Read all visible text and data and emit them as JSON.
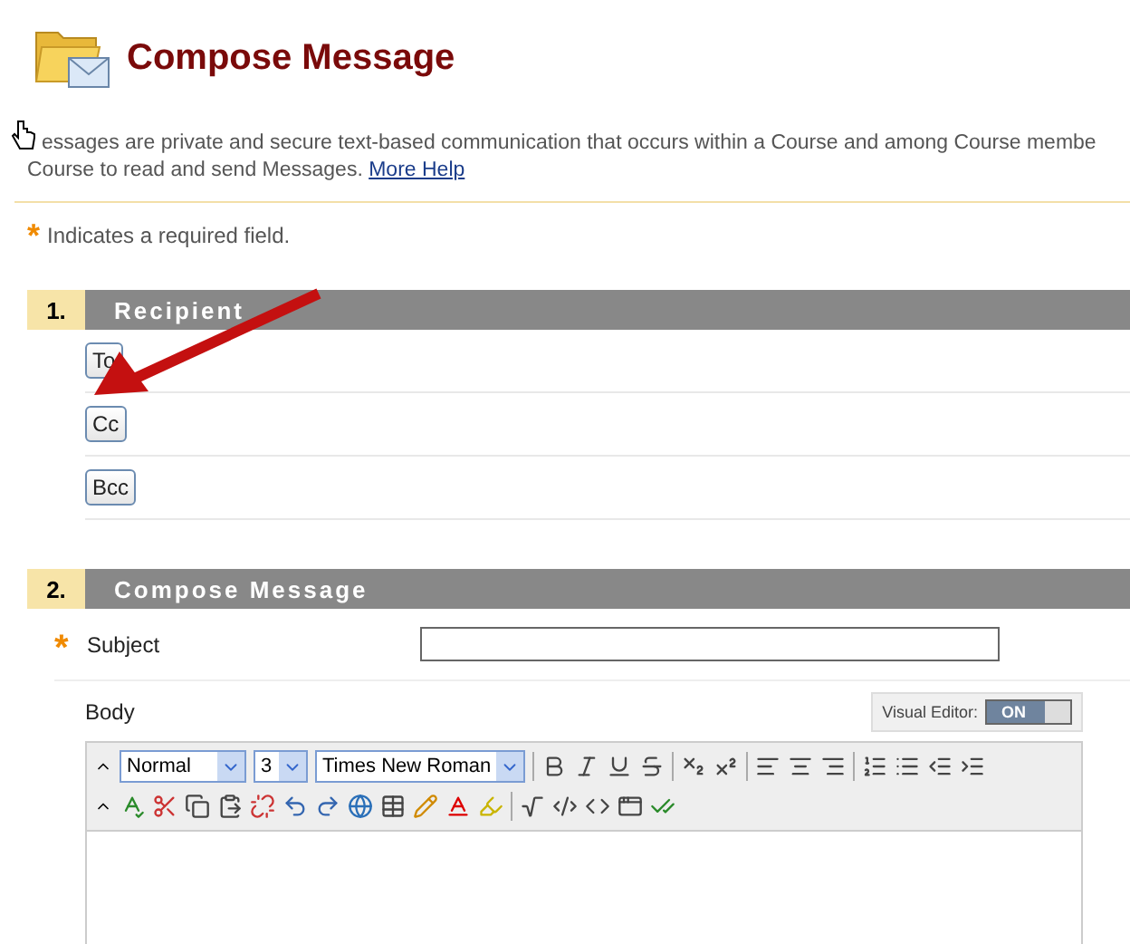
{
  "header": {
    "title": "Compose Message"
  },
  "intro": {
    "line_1": "essages are private and secure text-based communication that occurs within a Course and among Course membe",
    "line_2": "Course to read and send Messages.",
    "link": "More Help"
  },
  "required_note": {
    "mark": "*",
    "text": "Indicates a required field."
  },
  "recipients": {
    "number": "1.",
    "title": "Recipient",
    "buttons": [
      "To",
      "Cc",
      "Bcc"
    ]
  },
  "compose": {
    "number": "2.",
    "title": "Compose Message",
    "subject": {
      "mark": "*",
      "label": "Subject"
    },
    "body": {
      "label": "Body"
    },
    "visual_editor": {
      "label": "Visual Editor:",
      "state_label": "ON",
      "on": true
    },
    "selects": [
      "Normal",
      "3",
      "Times New Roman"
    ]
  }
}
